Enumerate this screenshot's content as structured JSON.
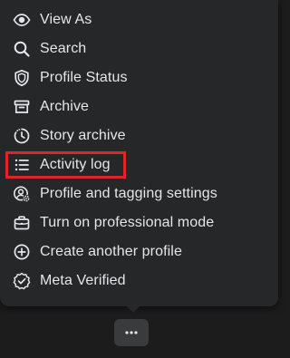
{
  "menu": {
    "items": [
      {
        "label": "View As",
        "icon": "eye-icon"
      },
      {
        "label": "Search",
        "icon": "search-icon"
      },
      {
        "label": "Profile Status",
        "icon": "shield-icon"
      },
      {
        "label": "Archive",
        "icon": "archive-box-icon"
      },
      {
        "label": "Story archive",
        "icon": "story-archive-clock-icon"
      },
      {
        "label": "Activity log",
        "icon": "list-icon",
        "highlighted": true
      },
      {
        "label": "Profile and tagging settings",
        "icon": "profile-gear-icon"
      },
      {
        "label": "Turn on professional mode",
        "icon": "briefcase-icon"
      },
      {
        "label": "Create another profile",
        "icon": "plus-circle-icon"
      },
      {
        "label": "Meta Verified",
        "icon": "verified-badge-icon"
      }
    ]
  },
  "more_button": {
    "icon": "ellipsis-icon"
  },
  "colors": {
    "menu_background": "#262728",
    "page_background": "#1c1c1d",
    "text": "#e4e6eb",
    "highlight_border": "#e0242a",
    "button_background": "#3a3b3c"
  }
}
